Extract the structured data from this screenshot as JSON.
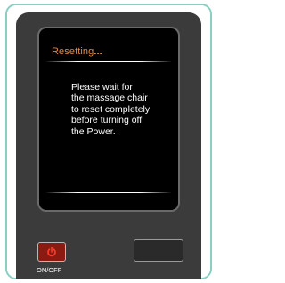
{
  "screen": {
    "title": "Resetting",
    "title_ellipsis": "...",
    "message_lines": [
      "Please wait for",
      "the massage chair",
      "to reset completely",
      "before turning off",
      "the Power."
    ]
  },
  "controls": {
    "power_label": "ON/OFF",
    "power_icon": "power-icon"
  },
  "colors": {
    "frame_border": "#8ad0c2",
    "remote_body": "#3b3b3b",
    "title": "#e8863a",
    "power_button": "#8b1a12",
    "power_icon": "#ff3b2a"
  }
}
